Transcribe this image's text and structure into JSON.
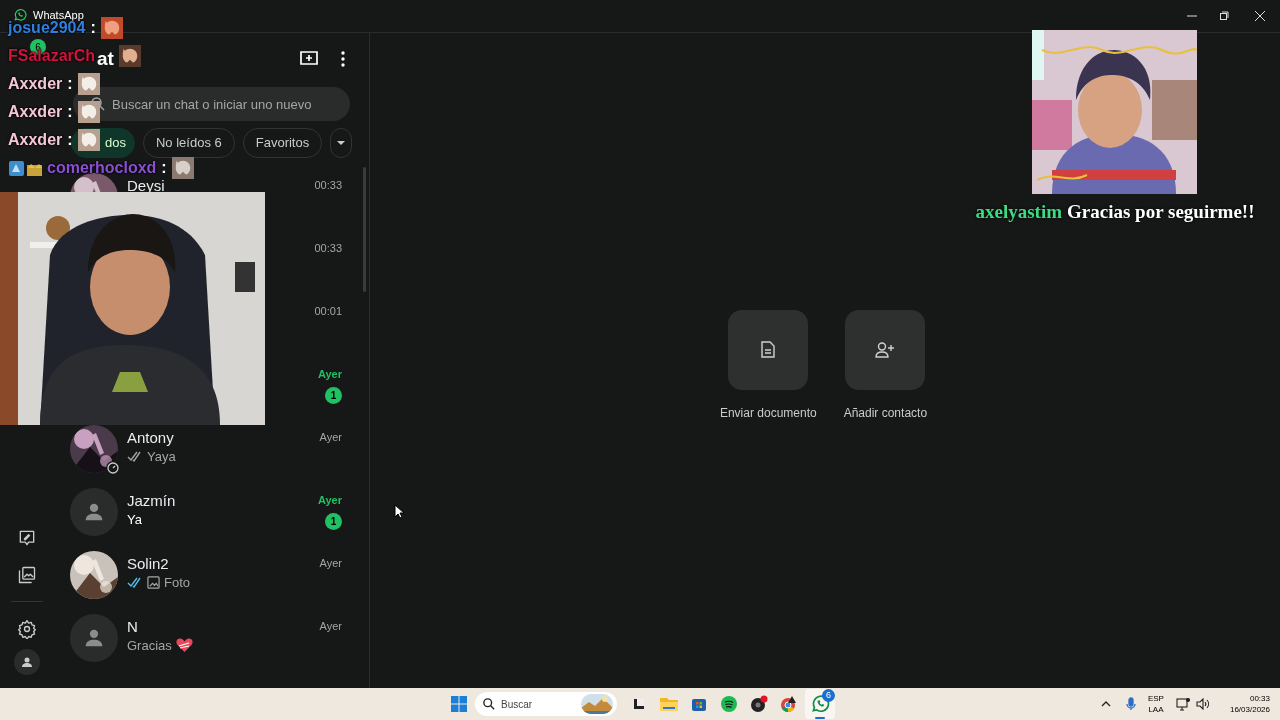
{
  "window": {
    "title": "WhatsApp"
  },
  "rail": {
    "chats_badge": "6"
  },
  "chat_list": {
    "title": "at",
    "search": {
      "placeholder": "Buscar un chat o iniciar uno nuevo"
    },
    "filters": [
      {
        "label": "dos",
        "selected": true
      },
      {
        "label": "No leídos 6",
        "selected": false
      },
      {
        "label": "Favoritos",
        "selected": false
      }
    ],
    "chats": [
      {
        "name": "Deysi",
        "time": "00:33",
        "unread": false,
        "photo_avatar": true
      },
      {
        "time": "00:33",
        "unread": false
      },
      {
        "time": "00:01",
        "unread": false
      },
      {
        "time": "Ayer",
        "unread": true,
        "badge": "1"
      },
      {
        "name": "Antony",
        "time": "Ayer",
        "unread": false,
        "photo_avatar": true,
        "status_ring": true,
        "ticks_read": false,
        "preview": "Yaya"
      },
      {
        "name": "Jazmín",
        "time": "Ayer",
        "unread": true,
        "badge": "1",
        "photo_avatar": false,
        "preview": "Ya"
      },
      {
        "name": "Solin2",
        "time": "Ayer",
        "unread": false,
        "photo_avatar": true,
        "ticks_read": true,
        "photo_icon": true,
        "preview": "Foto"
      },
      {
        "name": "N",
        "time": "Ayer",
        "unread": false,
        "photo_avatar": false,
        "preview": "Gracias",
        "heart": true
      }
    ]
  },
  "actions": [
    {
      "kind": "document",
      "label": "Enviar documento"
    },
    {
      "kind": "add-contact",
      "label": "Añadir contacto"
    }
  ],
  "stream_chat": [
    {
      "user": "josue2904",
      "color": "#2f7fe0",
      "colon": ":",
      "badges": false
    },
    {
      "user": "FSalazarCh",
      "color": "#d0143c",
      "badges": false
    },
    {
      "user": "Axxder",
      "color": "#f7c7d8",
      "colon": ":",
      "badges": false
    },
    {
      "user": "Axxder",
      "color": "#f7c7d8",
      "colon": ":",
      "badges": false
    },
    {
      "user": "Axxder",
      "color": "#f7c7d8",
      "colon": ":",
      "badges": false
    },
    {
      "user": "comerhocloxd",
      "color": "#8b4fd3",
      "colon": ":",
      "badges": true
    }
  ],
  "follow_alert": {
    "user": "axelyastim",
    "message": "Gracias por seguirme!!"
  },
  "taskbar": {
    "search": {
      "placeholder": "Buscar"
    },
    "whatsapp_badge": "6",
    "language": [
      "ESP",
      "LAA"
    ],
    "time": "00:33",
    "date": "16/03/2026"
  }
}
